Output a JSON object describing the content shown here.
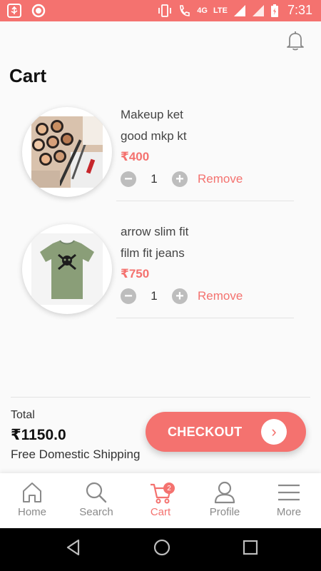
{
  "status_bar": {
    "time": "7:31",
    "network": "4G",
    "lte": "LTE",
    "icons": [
      "usb-icon",
      "record-icon",
      "vibrate-icon",
      "call-icon",
      "signal-icon",
      "battery-charging-icon"
    ]
  },
  "header": {
    "title": "Cart",
    "notification_icon": "bell-icon"
  },
  "cart": {
    "items": [
      {
        "name": "Makeup ket",
        "description": "good mkp kt",
        "price": "₹400",
        "quantity": "1",
        "remove_label": "Remove",
        "image": "makeup-palette"
      },
      {
        "name": "arrow slim fit",
        "description": "film fit jeans",
        "price": "₹750",
        "quantity": "1",
        "remove_label": "Remove",
        "image": "green-tshirt"
      }
    ]
  },
  "summary": {
    "total_label": "Total",
    "total_amount": "₹1150.0",
    "shipping_note": "Free Domestic Shipping",
    "checkout_label": "CHECKOUT"
  },
  "bottom_nav": {
    "items": [
      {
        "label": "Home",
        "icon": "home-icon"
      },
      {
        "label": "Search",
        "icon": "search-icon"
      },
      {
        "label": "Cart",
        "icon": "cart-icon",
        "badge": "2",
        "active": true
      },
      {
        "label": "Profile",
        "icon": "profile-icon"
      },
      {
        "label": "More",
        "icon": "menu-icon"
      }
    ]
  },
  "colors": {
    "accent": "#f4726f",
    "inactive": "#8a8a8a",
    "background": "#fafafa"
  }
}
